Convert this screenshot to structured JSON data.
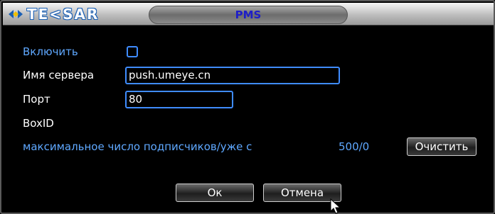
{
  "brand": {
    "logo_text": "TE<SAR"
  },
  "dialog": {
    "title": "PMS"
  },
  "form": {
    "enable_label": "Включить",
    "enable_checked": false,
    "server_label": "Имя сервера",
    "server_value": "push.umeye.cn",
    "port_label": "Порт",
    "port_value": "80",
    "boxid_label": "BoxID",
    "subscribers_label": "максимальное число подписчиков/уже с",
    "subscribers_value": "500/0"
  },
  "buttons": {
    "clear": "Очистить",
    "ok": "Ок",
    "cancel": "Отмена"
  },
  "colors": {
    "accent_blue": "#3f8cff",
    "label_blue": "#5fa8ff",
    "title_blue": "#1e1ec8"
  },
  "icons": {
    "logo": "diamond-arrows-icon",
    "close": "close-icon",
    "pointer": "mouse-pointer-icon"
  }
}
